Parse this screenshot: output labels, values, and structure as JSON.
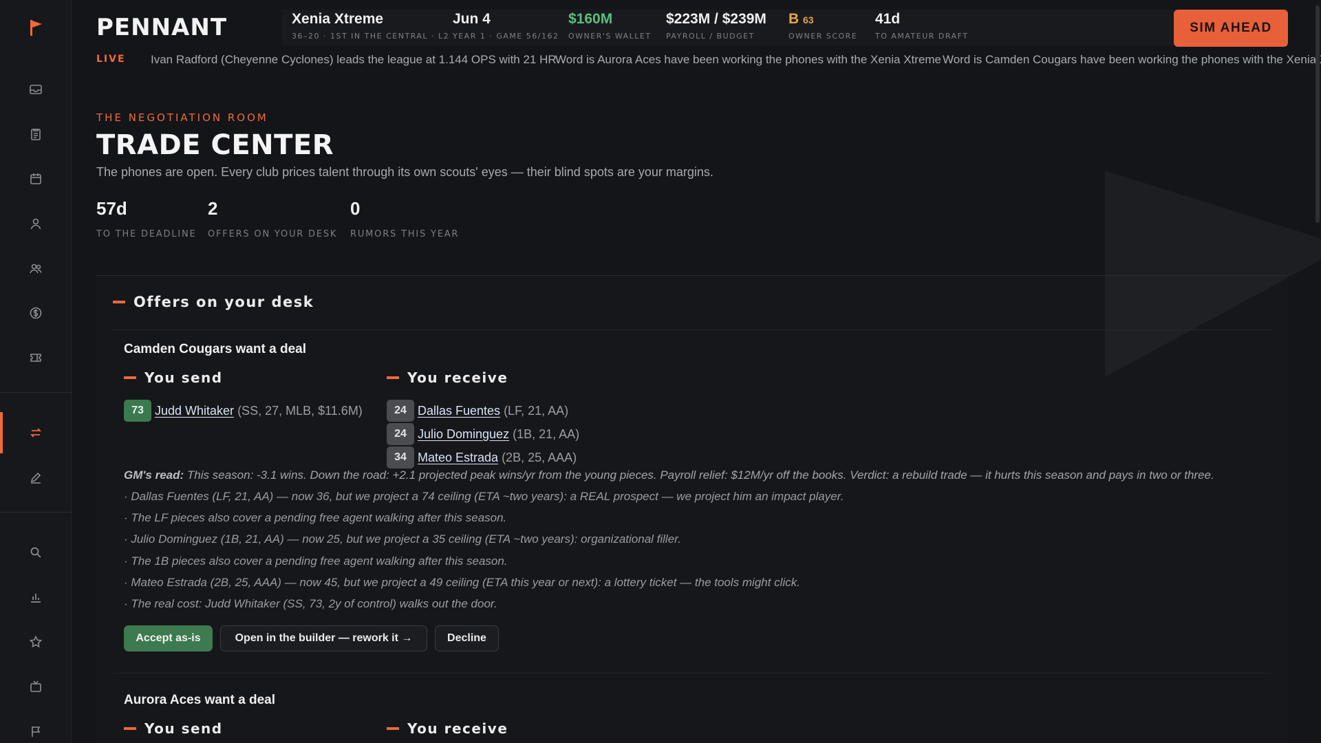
{
  "app": {
    "brand": "PENNANT"
  },
  "topbar": {
    "stats": [
      {
        "value": "Xenia Xtreme",
        "label": "36–20 · 1ST IN THE CENTRAL · L2"
      },
      {
        "value": "Jun 4",
        "label": "YEAR 1 · GAME 56/162"
      },
      {
        "value": "$160M",
        "label": "OWNER'S WALLET",
        "color": "#5bbf7c"
      },
      {
        "value": "$223M / $239M",
        "label": "PAYROLL / BUDGET"
      },
      {
        "grade": "B",
        "grade_num": "63",
        "label": "OWNER SCORE"
      },
      {
        "value": "41d",
        "label": "TO AMATEUR DRAFT"
      }
    ],
    "sim_button": "SIM AHEAD"
  },
  "ticker": {
    "live_label": "LIVE",
    "items": [
      "Ivan Radford (Cheyenne Cyclones) leads the league at 1.144 OPS with 21 HR",
      "Word is Aurora Aces have been working the phones with the Xenia Xtreme",
      "Word is Camden Cougars have been working the phones with the Xenia Xtreme"
    ]
  },
  "page": {
    "kicker": "THE NEGOTIATION ROOM",
    "title": "TRADE CENTER",
    "subtitle": "The phones are open. Every club prices talent through its own scouts' eyes — their blind spots are your margins.",
    "kpis": [
      {
        "value": "57d",
        "label": "TO THE DEADLINE"
      },
      {
        "value": "2",
        "label": "OFFERS ON YOUR DESK"
      },
      {
        "value": "0",
        "label": "RUMORS THIS YEAR"
      }
    ]
  },
  "offers_panel": {
    "title": "Offers on your desk",
    "send_label": "You send",
    "receive_label": "You receive",
    "offers": [
      {
        "title": "Camden Cougars want a deal",
        "send": [
          {
            "rating": "73",
            "name": "Judd Whitaker",
            "meta": "(SS, 27, MLB, $11.6M)"
          }
        ],
        "receive": [
          {
            "rating": "24",
            "name": "Dallas Fuentes",
            "meta": "(LF, 21, AA)"
          },
          {
            "rating": "24",
            "name": "Julio Dominguez",
            "meta": "(1B, 21, AA)"
          },
          {
            "rating": "34",
            "name": "Mateo Estrada",
            "meta": "(2B, 25, AAA)"
          }
        ],
        "gm_label": "GM's read:",
        "gm_read": " This season: -3.1 wins. Down the road: +2.1 projected peak wins/yr from the young pieces. Payroll relief: $12M/yr off the books. Verdict: a rebuild trade — it hurts this season and pays in two or three.",
        "notes": [
          "· Dallas Fuentes (LF, 21, AA) — now 36, but we project a 74 ceiling (ETA ~two years): a REAL prospect — we project him an impact player.",
          "· The LF pieces also cover a pending free agent walking after this season.",
          "· Julio Dominguez (1B, 21, AA) — now 25, but we project a 35 ceiling (ETA ~two years): organizational filler.",
          "· The 1B pieces also cover a pending free agent walking after this season.",
          "· Mateo Estrada (2B, 25, AAA) — now 45, but we project a 49 ceiling (ETA this year or next): a lottery ticket — the tools might click.",
          "· The real cost: Judd Whitaker (SS, 73, 2y of control) walks out the door."
        ],
        "actions": {
          "accept": "Accept as-is",
          "builder": "Open in the builder — rework it →",
          "decline": "Decline"
        }
      },
      {
        "title": "Aurora Aces want a deal"
      }
    ]
  },
  "colors": {
    "accent": "#ef6a3a",
    "positive": "#5bbf7c",
    "accept": "#3d7a4f",
    "grade": "#e8a54b"
  }
}
